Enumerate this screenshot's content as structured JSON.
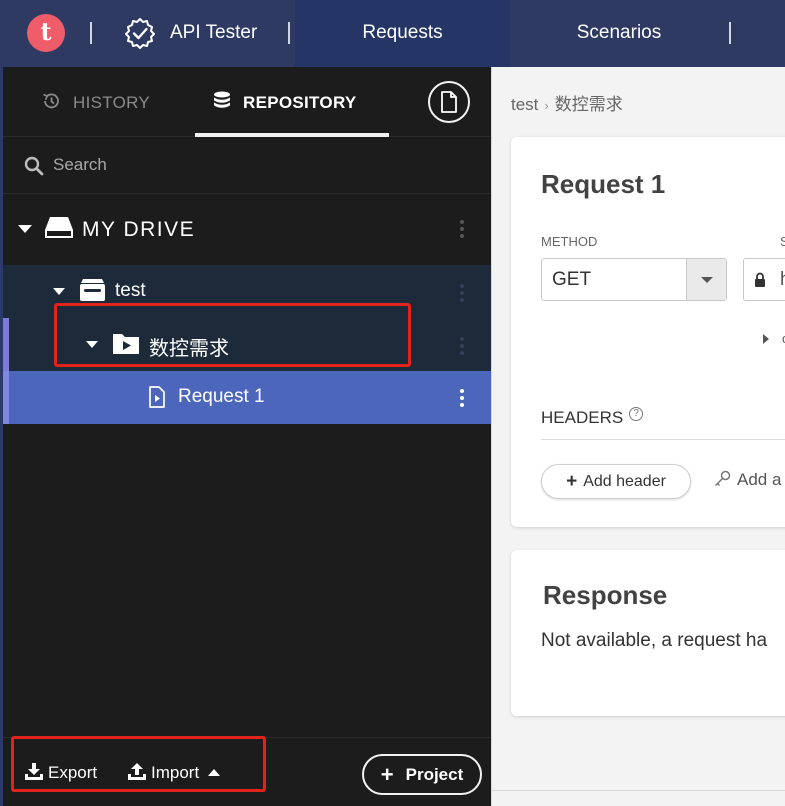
{
  "topbar": {
    "logo_letter": "t",
    "app_name": "API Tester",
    "tab_requests": "Requests",
    "tab_scenarios": "Scenarios"
  },
  "panel_tabs": {
    "history": "HISTORY",
    "repository": "REPOSITORY"
  },
  "search": {
    "placeholder": "Search"
  },
  "tree": {
    "drive": "MY DRIVE",
    "project": "test",
    "folder": "数控需求",
    "request": "Request 1"
  },
  "bottom": {
    "export": "Export",
    "import": "Import",
    "project": "Project"
  },
  "breadcrumb": {
    "project": "test",
    "folder": "数控需求"
  },
  "request_card": {
    "title": "Request 1",
    "method_label": "METHOD",
    "scheme_label_fragment": "S",
    "method_value": "GET",
    "url_fragment": "h",
    "collapsed_fragment": "c",
    "headers_label": "HEADERS",
    "help": "?",
    "add_header": "Add header",
    "add_auth_fragment": "Add a"
  },
  "response_card": {
    "title": "Response",
    "text": "Not available, a request ha"
  },
  "colors": {
    "topbar": "#2f3a63",
    "active_tab": "#243566",
    "selected_row": "#4c66bb",
    "highlight_box": "#e2231a",
    "logo": "#ef5d6a"
  }
}
